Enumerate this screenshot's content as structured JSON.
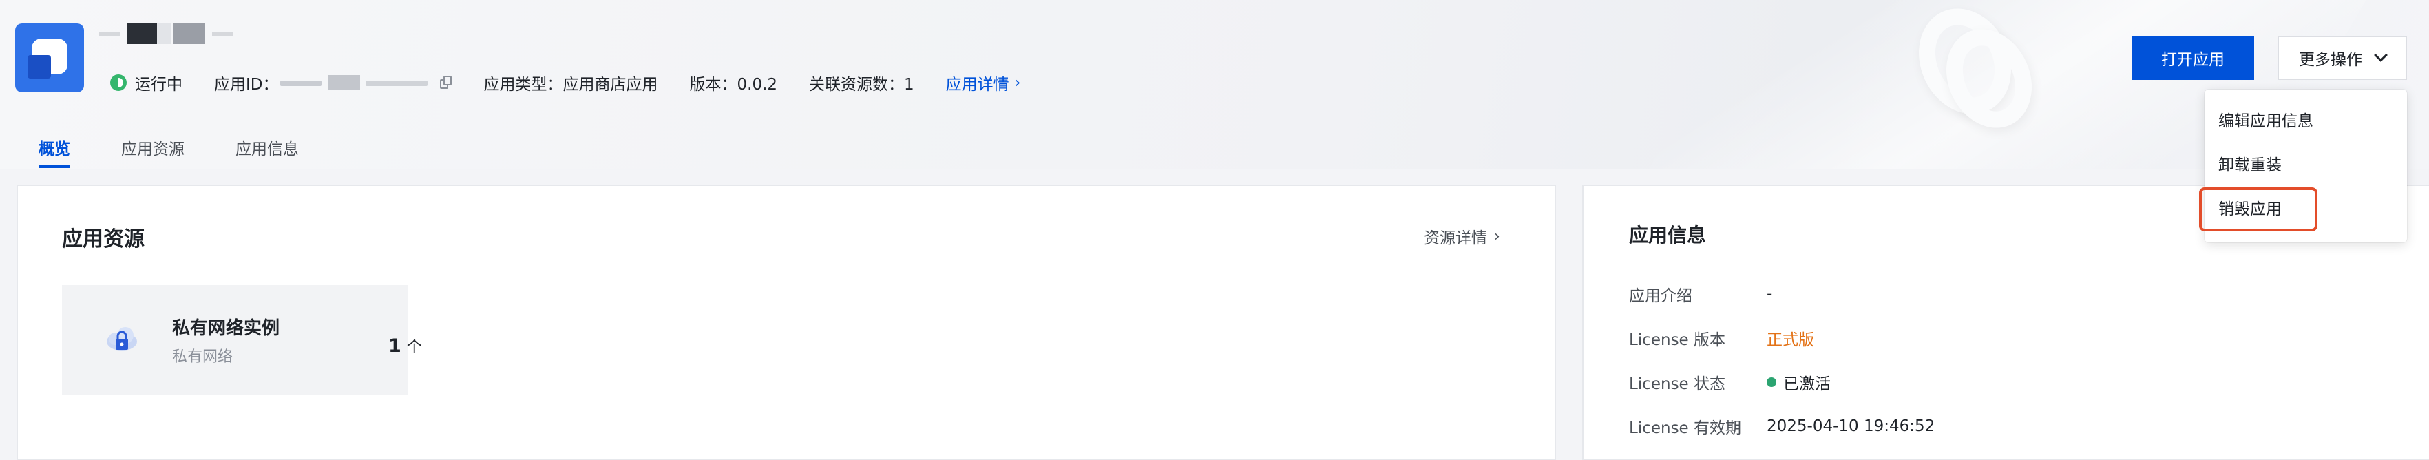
{
  "app": {
    "status": "运行中",
    "app_id_label": "应用ID：",
    "app_type": "应用类型：应用商店应用",
    "version": "版本：0.0.2",
    "linked_resources": "关联资源数：1",
    "detail_link": "应用详情",
    "chevron": "›"
  },
  "actions": {
    "open": "打开应用",
    "more": "更多操作"
  },
  "tabs": [
    {
      "label": "概览"
    },
    {
      "label": "应用资源"
    },
    {
      "label": "应用信息"
    }
  ],
  "resources_panel": {
    "title": "应用资源",
    "detail_link": "资源详情",
    "card": {
      "title": "私有网络实例",
      "subtitle": "私有网络",
      "count": "1",
      "unit": "个"
    }
  },
  "info_panel": {
    "title": "应用信息",
    "rows": [
      {
        "label": "应用介绍",
        "value": "-"
      },
      {
        "label": "License 版本",
        "value": "正式版"
      },
      {
        "label": "License 状态",
        "value": "已激活"
      },
      {
        "label": "License 有效期",
        "value": "2025-04-10 19:46:52"
      }
    ]
  },
  "dropdown": {
    "items": [
      {
        "label": "编辑应用信息"
      },
      {
        "label": "卸载重装"
      },
      {
        "label": "销毁应用"
      }
    ]
  },
  "colors": {
    "primary": "#0052d9",
    "running": "#35b66d",
    "active_dot": "#2ba471",
    "edition": "#e37318",
    "highlight": "#e34d2a"
  }
}
